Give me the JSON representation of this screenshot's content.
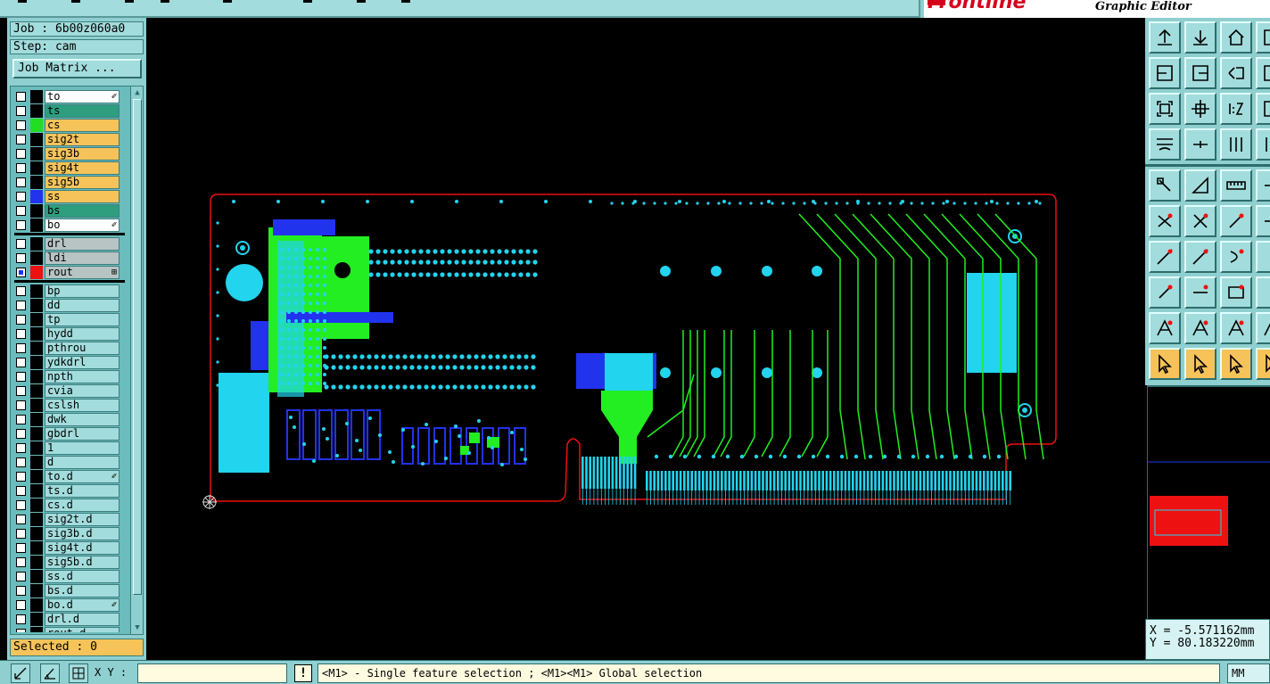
{
  "app": {
    "brand": "Frontline",
    "name": "Graphic Editor"
  },
  "job": {
    "job_line": "Job : 6b00z060a0",
    "step_line": "Step: cam",
    "matrix_button": "Job Matrix ..."
  },
  "layers": {
    "board": [
      {
        "name": "to",
        "color": "#000000",
        "bg": "white",
        "mark": "✐"
      },
      {
        "name": "ts",
        "color": "#000000",
        "bg": "green",
        "mark": ""
      },
      {
        "name": "cs",
        "color": "#22dd22",
        "bg": "tan",
        "mark": ""
      },
      {
        "name": "sig2t",
        "color": "#000000",
        "bg": "tan",
        "mark": ""
      },
      {
        "name": "sig3b",
        "color": "#000000",
        "bg": "tan",
        "mark": ""
      },
      {
        "name": "sig4t",
        "color": "#000000",
        "bg": "tan",
        "mark": ""
      },
      {
        "name": "sig5b",
        "color": "#000000",
        "bg": "tan",
        "mark": ""
      },
      {
        "name": "ss",
        "color": "#2233ee",
        "bg": "tan",
        "mark": ""
      },
      {
        "name": "bs",
        "color": "#000000",
        "bg": "green",
        "mark": ""
      },
      {
        "name": "bo",
        "color": "#000000",
        "bg": "white",
        "mark": "✐"
      }
    ],
    "drill": [
      {
        "name": "drl",
        "color": "#000000",
        "bg": "gray",
        "mark": ""
      },
      {
        "name": "ldi",
        "color": "#000000",
        "bg": "gray",
        "mark": ""
      },
      {
        "name": "rout",
        "color": "#ee1111",
        "bg": "gray",
        "mark": "⊞",
        "checked": true
      }
    ],
    "misc": [
      {
        "name": "bp",
        "mark": ""
      },
      {
        "name": "dd",
        "mark": ""
      },
      {
        "name": "tp",
        "mark": ""
      },
      {
        "name": "hydd",
        "mark": ""
      },
      {
        "name": "pthrou",
        "mark": ""
      },
      {
        "name": "ydkdrl",
        "mark": ""
      },
      {
        "name": "npth",
        "mark": ""
      },
      {
        "name": "cvia",
        "mark": ""
      },
      {
        "name": "cslsh",
        "mark": ""
      },
      {
        "name": "dwk",
        "mark": ""
      },
      {
        "name": "gbdrl",
        "mark": ""
      },
      {
        "name": "1",
        "mark": ""
      },
      {
        "name": "d",
        "mark": ""
      },
      {
        "name": "to.d",
        "mark": "✐"
      },
      {
        "name": "ts.d",
        "mark": ""
      },
      {
        "name": "cs.d",
        "mark": ""
      },
      {
        "name": "sig2t.d",
        "mark": ""
      },
      {
        "name": "sig3b.d",
        "mark": ""
      },
      {
        "name": "sig4t.d",
        "mark": ""
      },
      {
        "name": "sig5b.d",
        "mark": ""
      },
      {
        "name": "ss.d",
        "mark": ""
      },
      {
        "name": "bs.d",
        "mark": ""
      },
      {
        "name": "bo.d",
        "mark": "✐"
      },
      {
        "name": "drl.d",
        "mark": ""
      },
      {
        "name": "rout.d",
        "mark": ""
      }
    ]
  },
  "selected": "Selected : 0",
  "coords": {
    "x": "X = -5.571162mm",
    "y": "Y = 80.183220mm"
  },
  "status": {
    "xy_label": "X Y :",
    "xy_value": "",
    "message_icon": "!",
    "message": "<M1> - Single feature selection ; <M1><M1> Global selection",
    "units": "MM"
  },
  "colors": {
    "panel": "#8fcfcf",
    "outline": "#ee1111",
    "cyan_pads": "#22d4ee",
    "green_copper": "#22ee22",
    "blue_copper": "#2233ee"
  }
}
